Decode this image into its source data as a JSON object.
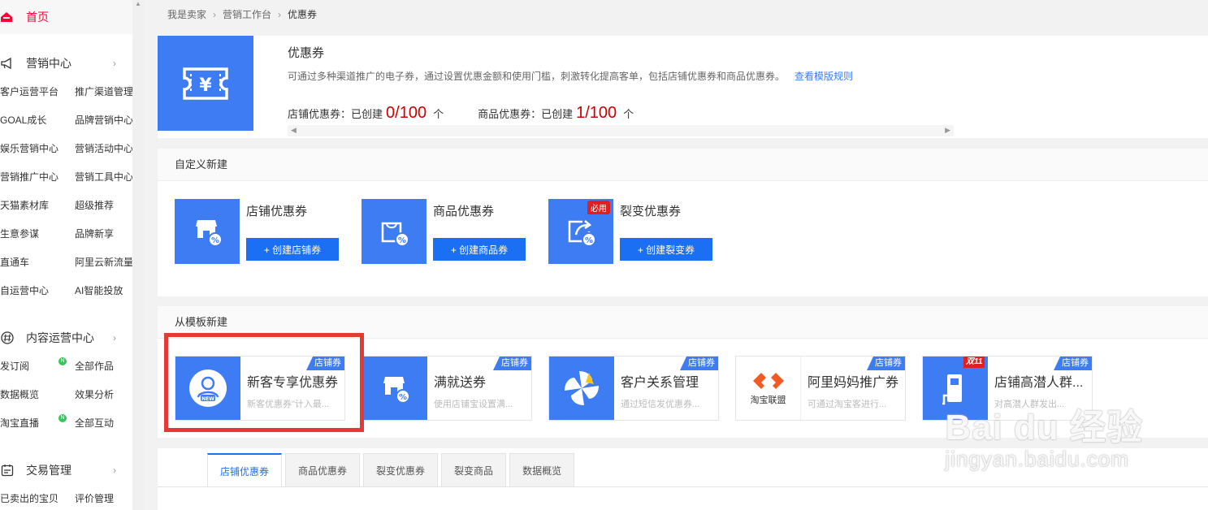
{
  "sidebar": {
    "home": "首页",
    "sections": [
      {
        "title": "营销中心",
        "icon": "megaphone-icon",
        "items": [
          {
            "label": "客户运营平台"
          },
          {
            "label": "推广渠道管理"
          },
          {
            "label": "GOAL成长"
          },
          {
            "label": "品牌营销中心"
          },
          {
            "label": "娱乐营销中心"
          },
          {
            "label": "营销活动中心"
          },
          {
            "label": "营销推广中心"
          },
          {
            "label": "营销工具中心"
          },
          {
            "label": "天猫素材库"
          },
          {
            "label": "超级推荐"
          },
          {
            "label": "生意参谋"
          },
          {
            "label": "品牌新享"
          },
          {
            "label": "直通车"
          },
          {
            "label": "阿里云新流量"
          },
          {
            "label": "自运营中心"
          },
          {
            "label": "AI智能投放"
          }
        ]
      },
      {
        "title": "内容运营中心",
        "icon": "hashtag-icon",
        "items": [
          {
            "label": "发订阅",
            "dot": ""
          },
          {
            "label": "全部作品",
            "dot": "N"
          },
          {
            "label": "数据概览",
            "dot": ""
          },
          {
            "label": "效果分析",
            "dot": ""
          },
          {
            "label": "淘宝直播",
            "dot": ""
          },
          {
            "label": "全部互动",
            "dot": "N"
          }
        ]
      },
      {
        "title": "交易管理",
        "icon": "calendar-icon",
        "items": [
          {
            "label": "已卖出的宝贝"
          },
          {
            "label": "评价管理"
          }
        ]
      }
    ]
  },
  "breadcrumb": [
    "我是卖家",
    "营销工作台",
    "优惠券"
  ],
  "overview": {
    "title": "优惠券",
    "description": "可通过多种渠道推广的电子券，通过设置优惠金额和使用门槛，刺激转化提高客单，包括店铺优惠券和商品优惠券。",
    "link": "查看模版规则",
    "stats": [
      {
        "label": "店铺优惠券：已创建",
        "value": "0/100",
        "unit": "个"
      },
      {
        "label": "商品优惠券：已创建",
        "value": "1/100",
        "unit": "个"
      }
    ]
  },
  "custom": {
    "title": "自定义新建",
    "cards": [
      {
        "name": "店铺优惠券",
        "button": "+ 创建店铺券",
        "badge": ""
      },
      {
        "name": "商品优惠券",
        "button": "+ 创建商品券",
        "badge": ""
      },
      {
        "name": "裂变优惠券",
        "button": "+ 创建裂变券",
        "badge": "必用"
      }
    ]
  },
  "template": {
    "title": "从模板新建",
    "cards": [
      {
        "name": "新客专享优惠券",
        "desc": "新客优惠券\"计入最...",
        "tag": "店铺券"
      },
      {
        "name": "满就送券",
        "desc": "使用店铺宝设置满...",
        "tag": "店铺券"
      },
      {
        "name": "客户关系管理",
        "desc": "通过短信发优惠券...",
        "tag": "店铺券"
      },
      {
        "name": "阿里妈妈推广券",
        "desc": "可通过淘宝客进行...",
        "tag": "店铺券",
        "logo_text": "淘宝联盟"
      },
      {
        "name": "店铺高潜人群...",
        "desc": "对高潜人群发出...",
        "tag": "店铺券",
        "double": "双11"
      }
    ]
  },
  "tabs": [
    "店铺优惠券",
    "商品优惠券",
    "裂变优惠券",
    "裂变商品",
    "数据概览"
  ],
  "watermark": {
    "line1": "Bai du 经验",
    "line2": "jingyan.baidu.com"
  },
  "colors": {
    "accent": "#3d7cf2",
    "button": "#1a6ff3",
    "highlight": "#e53935",
    "home": "#ff0036"
  }
}
